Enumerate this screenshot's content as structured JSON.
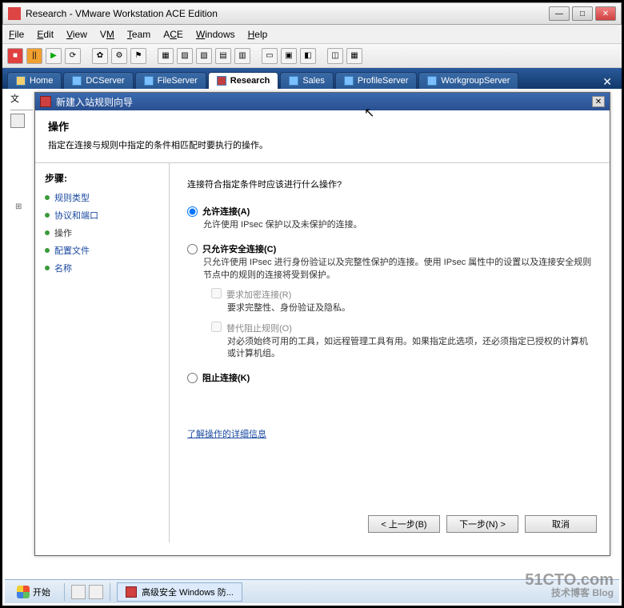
{
  "app_title": "Research - VMware Workstation ACE Edition",
  "menubar": [
    "File",
    "Edit",
    "View",
    "VM",
    "Team",
    "ACE",
    "Windows",
    "Help"
  ],
  "tabs": [
    {
      "label": "Home"
    },
    {
      "label": "DCServer"
    },
    {
      "label": "FileServer"
    },
    {
      "label": "Research",
      "active": true
    },
    {
      "label": "Sales"
    },
    {
      "label": "ProfileServer"
    },
    {
      "label": "WorkgroupServer"
    }
  ],
  "left_label": "文",
  "wizard": {
    "title": "新建入站规则向导",
    "heading": "操作",
    "subheading": "指定在连接与规则中指定的条件相匹配时要执行的操作。",
    "steps_header": "步骤:",
    "steps": [
      "规则类型",
      "协议和端口",
      "操作",
      "配置文件",
      "名称"
    ],
    "current_step": 2,
    "question": "连接符合指定条件时应该进行什么操作?",
    "options": [
      {
        "title": "允许连接(A)",
        "desc": "允许使用 IPsec 保护以及未保护的连接。",
        "selected": true
      },
      {
        "title": "只允许安全连接(C)",
        "desc": "只允许使用 IPsec 进行身份验证以及完整性保护的连接。使用 IPsec 属性中的设置以及连接安全规则节点中的规则的连接将受到保护。",
        "selected": false,
        "subs": [
          {
            "title": "要求加密连接(R)",
            "desc": "要求完整性、身份验证及隐私。"
          },
          {
            "title": "替代阻止规则(O)",
            "desc": "对必须始终可用的工具，如远程管理工具有用。如果指定此选项，还必须指定已授权的计算机或计算机组。"
          }
        ]
      },
      {
        "title": "阻止连接(K)",
        "desc": "",
        "selected": false
      }
    ],
    "link": "了解操作的详细信息",
    "buttons": {
      "back": "< 上一步(B)",
      "next": "下一步(N) >",
      "cancel": "取消"
    }
  },
  "taskbar": {
    "start": "开始",
    "task": "高级安全 Windows 防..."
  },
  "watermark": {
    "line1": "51CTO.com",
    "line2": "技术博客 Blog"
  }
}
